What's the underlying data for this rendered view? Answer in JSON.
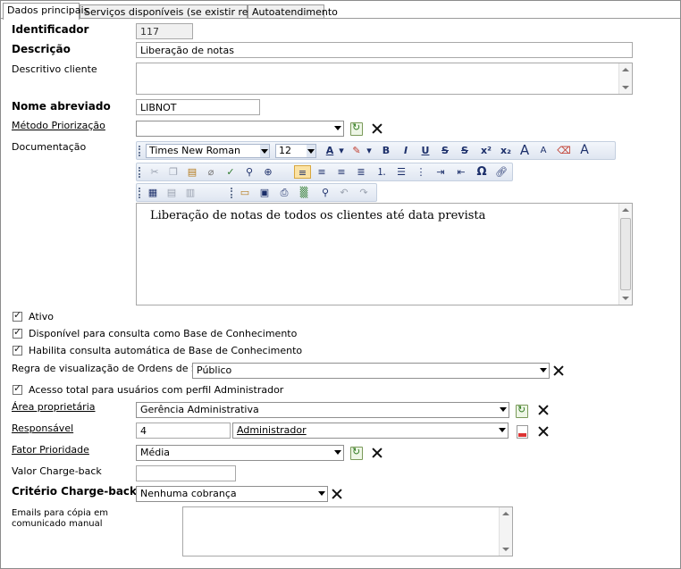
{
  "tabs": [
    {
      "label": "Dados principais"
    },
    {
      "label": "Serviços disponíveis (se existir restrição)"
    },
    {
      "label": "Autoatendimento"
    }
  ],
  "fields": {
    "identificador": {
      "label": "Identificador",
      "value": "117"
    },
    "descricao": {
      "label": "Descrição",
      "value": "Liberação de notas"
    },
    "descritivo_cliente": {
      "label": "Descritivo cliente",
      "value": ""
    },
    "nome_abreviado": {
      "label": "Nome abreviado",
      "value": "LIBNOT"
    },
    "metodo_priorizacao": {
      "label": "Método Priorização",
      "value": ""
    },
    "documentacao": {
      "label": "Documentação",
      "content": "Liberação de notas de todos os clientes até data prevista"
    }
  },
  "editor_toolbar": {
    "font_name": "Times New Roman",
    "font_size": "12",
    "glyphs": {
      "bold": "B",
      "italic": "I",
      "underline": "U",
      "strike": "S",
      "strike2": "S",
      "superscript": "x²",
      "subscript": "x₂",
      "grow": "A",
      "shrink": "A",
      "forecolor": "A",
      "fontcolor": "A",
      "omega": "Ω"
    }
  },
  "checks": {
    "ativo": {
      "label": "Ativo",
      "checked": true
    },
    "base_conhecimento": {
      "label": "Disponível para consulta como Base de Conhecimento",
      "checked": true
    },
    "consulta_automatica": {
      "label": "Habilita consulta automática de Base de Conhecimento",
      "checked": true
    },
    "acesso_admin": {
      "label": "Acesso total para usuários com perfil Administrador",
      "checked": true
    }
  },
  "regra_visualizacao": {
    "label": "Regra de visualização de Ordens de Serviço",
    "value": "Público"
  },
  "area_proprietaria": {
    "label": "Área proprietária",
    "value": "Gerência Administrativa"
  },
  "responsavel": {
    "label": "Responsável",
    "code": "4",
    "value": "Administrador"
  },
  "fator_prioridade": {
    "label": "Fator Prioridade",
    "value": "Média"
  },
  "valor_chargeback": {
    "label": "Valor Charge-back",
    "value": ""
  },
  "criterio_chargeback": {
    "label": "Critério Charge-back",
    "value": "Nenhuma cobrança"
  },
  "emails_copia": {
    "label_line1": "Emails para cópia em",
    "label_line2": "comunicado manual",
    "value": ""
  }
}
